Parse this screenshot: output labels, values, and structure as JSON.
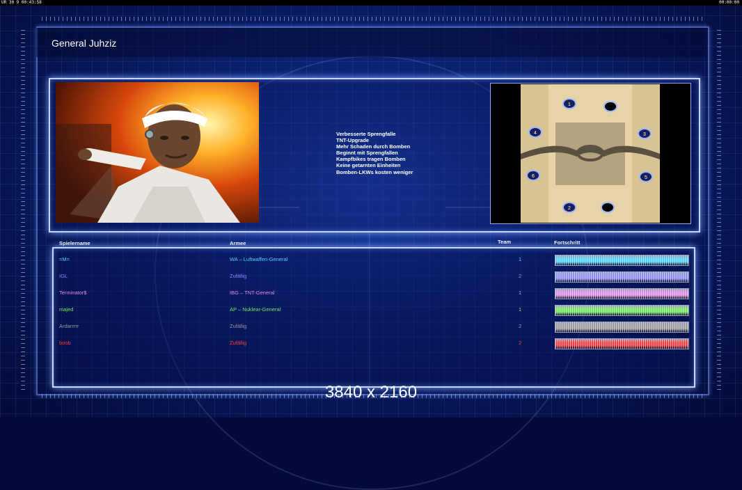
{
  "hud": {
    "left_text": "UR 30 9 00:43:58",
    "right_text": "00:00:00"
  },
  "general": {
    "name": "General Juhziz"
  },
  "bonuses": [
    "Verbesserte Sprengfalle",
    "TNT-Upgrade",
    "Mehr Schaden durch Bomben",
    "Beginnt mit Sprengfallen",
    "Kampfbikes tragen Bomben",
    "Keine getarnten Einheiten",
    "Bomben-LKWs kosten weniger"
  ],
  "map": {
    "spawns": [
      "1",
      "",
      "4",
      "3",
      "6",
      "5",
      "2",
      ""
    ]
  },
  "table": {
    "headers": {
      "player": "Spielername",
      "army": "Armee",
      "team": "Team",
      "progress": "Fortschritt"
    },
    "rows": [
      {
        "player": "=M=",
        "army": "WA – Luftwaffen-General",
        "team": "1",
        "color": "#4fd0ff",
        "progress": 1.0
      },
      {
        "player": "IGL",
        "army": "Zufällig",
        "team": "2",
        "color": "#8a8cff",
        "progress": 1.0
      },
      {
        "player": "Terminator$",
        "army": "IBG – TNT-General",
        "team": "1",
        "color": "#e08ae8",
        "progress": 1.0
      },
      {
        "player": "majed",
        "army": "AP – Nuklear-General",
        "team": "1",
        "color": "#6ee85a",
        "progress": 1.0
      },
      {
        "player": "Ardarrrrr",
        "army": "Zufällig",
        "team": "2",
        "color": "#9a9a9a",
        "progress": 1.0
      },
      {
        "player": "boob",
        "army": "Zufällig",
        "team": "2",
        "color": "#ff3a3a",
        "progress": 1.0
      }
    ]
  },
  "watermark": "3840 x 2160"
}
